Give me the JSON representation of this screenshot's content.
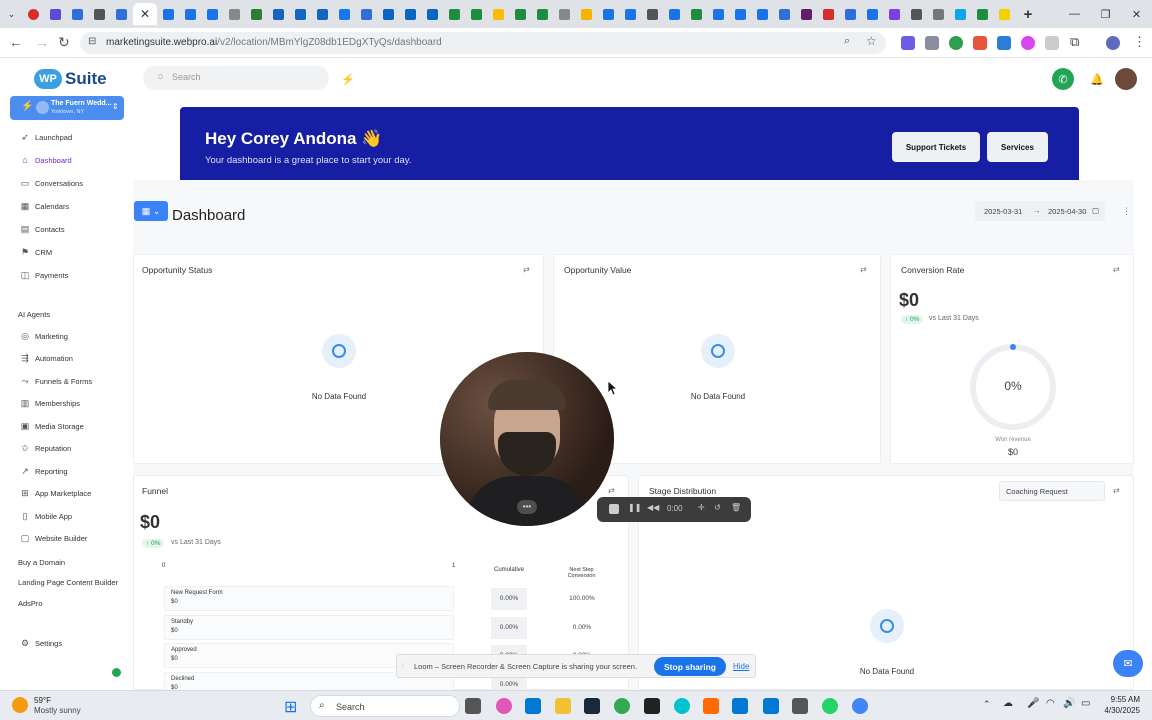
{
  "browser": {
    "url_host": "marketingsuite.webpro.ai",
    "url_path": "/v2/location/MBmYlgZ08db1EDgXTyQs/dashboard",
    "active_tab_close": "✕",
    "new_tab": "+"
  },
  "app": {
    "logo_badge": "WP",
    "logo_text": "Suite",
    "search_placeholder": "Search",
    "subaccount": {
      "name": "The Fuern Wedd...",
      "location": "Yorktown, NY"
    }
  },
  "sidebar": {
    "items": [
      {
        "label": "Launchpad",
        "icon": "rocket-icon"
      },
      {
        "label": "Dashboard",
        "icon": "home-icon",
        "active": true
      },
      {
        "label": "Conversations",
        "icon": "chat-icon"
      },
      {
        "label": "Calendars",
        "icon": "calendar-icon"
      },
      {
        "label": "Contacts",
        "icon": "contacts-icon"
      },
      {
        "label": "CRM",
        "icon": "filter-icon"
      },
      {
        "label": "Payments",
        "icon": "payments-icon"
      }
    ],
    "section_ai": "AI Agents",
    "items2": [
      {
        "label": "Marketing",
        "icon": "globe-icon"
      },
      {
        "label": "Automation",
        "icon": "automation-icon"
      },
      {
        "label": "Funnels & Forms",
        "icon": "funnel-icon"
      },
      {
        "label": "Memberships",
        "icon": "membership-icon"
      },
      {
        "label": "Media Storage",
        "icon": "storage-icon"
      },
      {
        "label": "Reputation",
        "icon": "star-icon"
      },
      {
        "label": "Reporting",
        "icon": "chart-icon"
      },
      {
        "label": "App Marketplace",
        "icon": "grid-icon"
      },
      {
        "label": "Mobile App",
        "icon": "phone-icon"
      },
      {
        "label": "Website Builder",
        "icon": "browser-icon"
      }
    ],
    "extra_items": [
      "Buy a Domain",
      "Landing Page Content Builder",
      "AdsPro"
    ],
    "settings": "Settings"
  },
  "hero": {
    "title": "Hey Corey Andona 👋",
    "subtitle": "Your dashboard is a great place to start your day.",
    "btn_support": "Support Tickets",
    "btn_services": "Services"
  },
  "dashboard": {
    "title": "Dashboard",
    "date_from": "2025-03-31",
    "date_arrow": "→",
    "date_to": "2025-04-30",
    "opportunity_status": {
      "title": "Opportunity Status",
      "empty": "No Data Found"
    },
    "opportunity_value": {
      "title": "Opportunity Value",
      "empty": "No Data Found"
    },
    "conversion_rate": {
      "title": "Conversion Rate",
      "value": "$0",
      "delta": "↑ 0%",
      "compare": "vs Last 31 Days",
      "gauge_value": 0,
      "gauge_label": "0%",
      "won_label": "Won revenue",
      "won_value": "$0"
    },
    "funnel": {
      "title": "Funnel",
      "value": "$0",
      "delta": "↑ 0%",
      "compare": "vs Last 31 Days",
      "axis_min": "0",
      "axis_max": "1",
      "col_cumulative": "Cumulative",
      "col_next": "Next Step Conversion",
      "stages": [
        {
          "name": "New Request Form",
          "value": "$0",
          "cumulative": "0.00%",
          "next": "100.00%"
        },
        {
          "name": "Standby",
          "value": "$0",
          "cumulative": "0.00%",
          "next": "0.00%"
        },
        {
          "name": "Approved",
          "value": "$0",
          "cumulative": "0.00%",
          "next": "0.00%"
        },
        {
          "name": "Declined",
          "value": "$0",
          "cumulative": "0.00%",
          "next": ""
        }
      ]
    },
    "stage_distribution": {
      "title": "Stage Distribution",
      "pipeline": "Coaching Request",
      "empty": "No Data Found"
    }
  },
  "loom": {
    "time": "0:00",
    "share_message": "Loom – Screen Recorder & Screen Capture is sharing your screen.",
    "stop": "Stop sharing",
    "hide": "Hide"
  },
  "taskbar": {
    "temp": "59°F",
    "weather": "Mostly sunny",
    "search": "Search",
    "time": "9:55 AM",
    "date": "4/30/2025"
  }
}
